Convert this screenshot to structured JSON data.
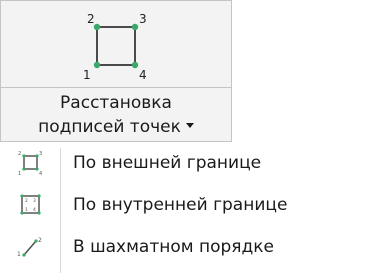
{
  "button": {
    "label_line1": "Расстановка",
    "label_line2": "подписей точек",
    "icon": "point-labels-icon",
    "corner_labels": [
      "2",
      "3",
      "1",
      "4"
    ]
  },
  "menu": {
    "items": [
      {
        "label": "По внешней границе",
        "icon": "outer-border-icon"
      },
      {
        "label": "По внутренней границе",
        "icon": "inner-border-icon"
      },
      {
        "label": "В шахматном порядке",
        "icon": "checkerboard-order-icon",
        "icon_labels": [
          "1",
          "2"
        ]
      }
    ]
  },
  "colors": {
    "accent_green": "#3aa86a",
    "line_dark": "#4a4a4a",
    "ribbon_bg": "#f3f3f3",
    "border": "#c5c5c5"
  }
}
